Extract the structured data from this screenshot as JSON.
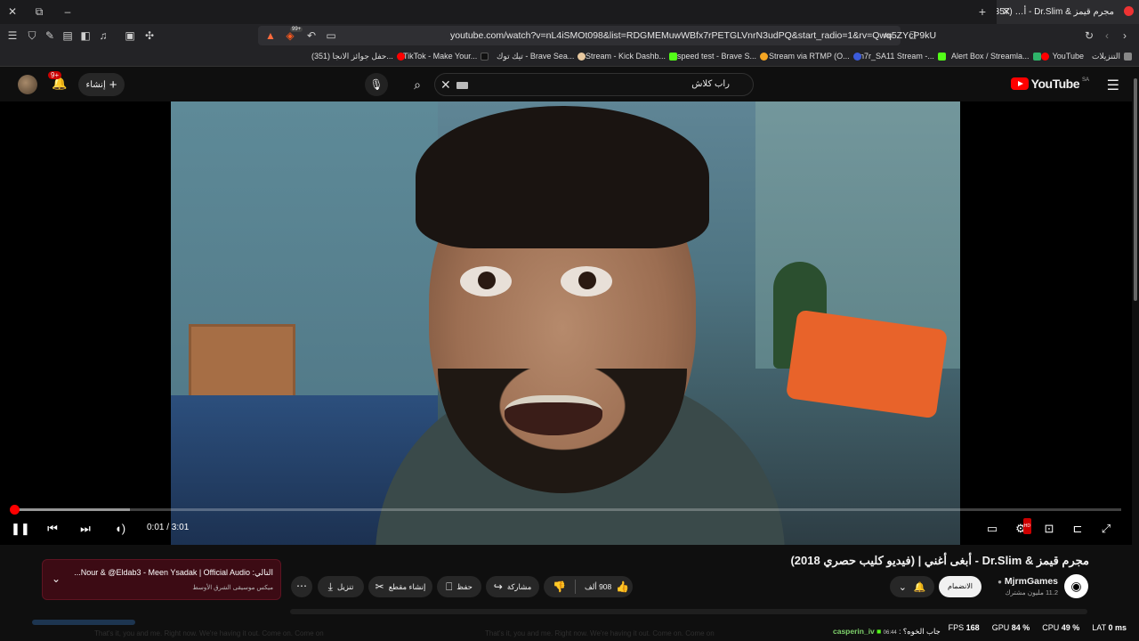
{
  "browser": {
    "tab_title": "مجرم قيمز & Dr.Slim - أ… (357)",
    "url": "youtube.com/watch?v=nL4iSMOt098&list=RDGMEMuwWBfx7rPETGLVnrN3udPQ&start_radio=1&rv=Qwq5ZYcP9kU",
    "shields_count": "99+",
    "bookmarks": [
      {
        "label": "التنزيلات",
        "color": "#888888"
      },
      {
        "label": "YouTube",
        "color": "#ff0000"
      },
      {
        "label": "Alert Box / Streamla...",
        "color": "#2fb36a"
      },
      {
        "label": "n7r_SA11 Stream -...",
        "color": "#53fc18"
      },
      {
        "label": "Stream via RTMP (O...",
        "color": "#3b5bdb"
      },
      {
        "label": "speed test - Brave S...",
        "color": "#f5a623"
      },
      {
        "label": "Stream - Kick Dashb...",
        "color": "#53fc18"
      },
      {
        "label": "تيك توك - Brave Sea...",
        "color": "#e8c9a0"
      },
      {
        "label": "TikTok - Make Your...",
        "color": "#111111"
      },
      {
        "label": "(351) حفل جوائز الانجا...",
        "color": "#ff0000"
      }
    ]
  },
  "youtube": {
    "logo_text": "YouTube",
    "region": "SA",
    "search_query": "راب كلاش",
    "create_label": "إنشاء",
    "notif_badge": "9+",
    "player": {
      "time": "0:01 / 3:01",
      "progress_fraction": 0.001,
      "buffer_fraction": 0.107
    },
    "video_title": "مجرم قيمز & Dr.Slim - أبغى أغني | (فيديو كليب حصري 2018)",
    "channel_name": "MjrmGames",
    "subscribers": "11.2 مليون مشترك",
    "join_label": "الانضمام",
    "likes": "908 ألف",
    "share_label": "مشاركة",
    "save_label": "حفظ",
    "clip_label": "إنشاء مقطع",
    "download_label": "تنزيل",
    "up_next_title": "التالي: Nour & @Eldab3 - Meen Ysadak | Official Audio...",
    "up_next_sub": "ميكس موسيقى الشرق الأوسط"
  },
  "overlay": {
    "fps_label": "FPS",
    "fps_value": "168",
    "gpu_label": "GPU",
    "gpu_value": "84 %",
    "cpu_label": "CPU",
    "cpu_value": "49 %",
    "lat_label": "LAT",
    "lat_value": "0 ms",
    "chat_user": "casperin_iv",
    "chat_msg": "جاب الخوه؟ :",
    "chat_time": "06:44",
    "lyrics_a": "That's it, you and me. Right now. We're having it out. Come on. Come on",
    "lyrics_b": "That's it, you and me. Right now. We're having it out. Come on. Come on"
  }
}
